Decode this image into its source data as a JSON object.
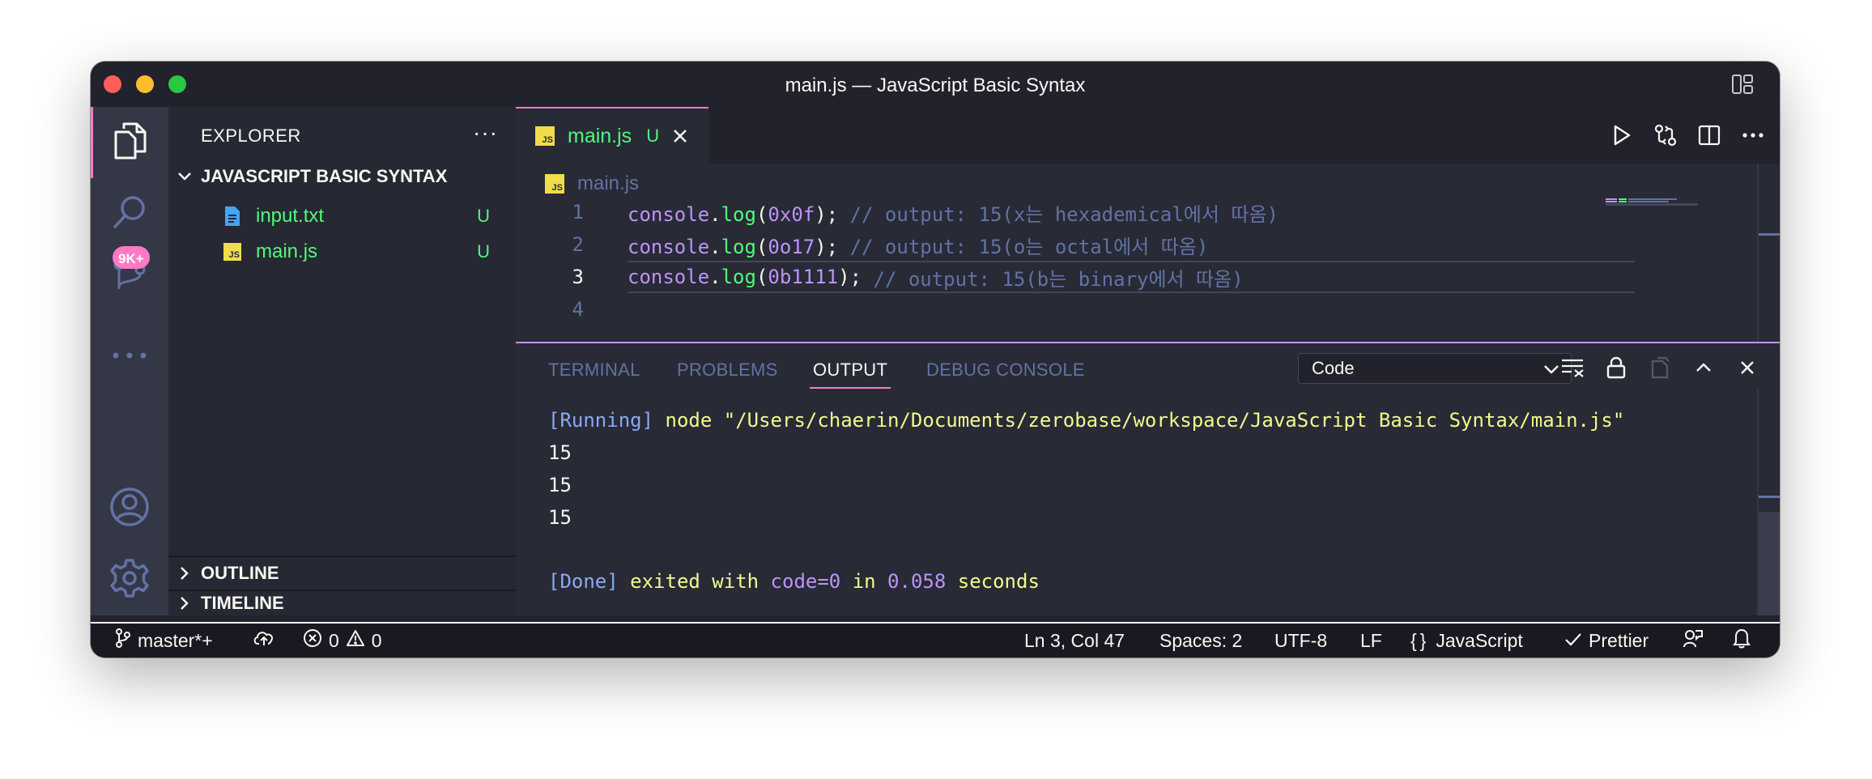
{
  "window": {
    "title": "main.js — JavaScript Basic Syntax"
  },
  "activity_bar": {
    "scm_badge": "9K+"
  },
  "explorer": {
    "title": "EXPLORER",
    "more": "···",
    "folder": "JAVASCRIPT BASIC SYNTAX",
    "files": [
      {
        "name": "input.txt",
        "status": "U",
        "icon": "text-file-icon"
      },
      {
        "name": "main.js",
        "status": "U",
        "icon": "js-file-icon"
      }
    ],
    "outline": "OUTLINE",
    "timeline": "TIMELINE"
  },
  "editor": {
    "tab": {
      "label": "main.js",
      "status": "U",
      "icon_text": "JS"
    },
    "breadcrumb": "main.js",
    "lines": [
      {
        "num": "1",
        "obj": "console",
        "dot": ".",
        "fn": "log",
        "open": "(",
        "arg": "0x0f",
        "close": ");",
        "comment": " // output: 15(x는 hexademical에서 따옴)"
      },
      {
        "num": "2",
        "obj": "console",
        "dot": ".",
        "fn": "log",
        "open": "(",
        "arg": "0o17",
        "close": ");",
        "comment": " // output: 15(o는 octal에서 따옴)"
      },
      {
        "num": "3",
        "obj": "console",
        "dot": ".",
        "fn": "log",
        "open": "(",
        "arg": "0b1111",
        "close": ");",
        "comment": " // output: 15(b는 binary에서 따옴)"
      },
      {
        "num": "4"
      }
    ]
  },
  "panel": {
    "tabs": [
      "TERMINAL",
      "PROBLEMS",
      "OUTPUT",
      "DEBUG CONSOLE"
    ],
    "active_tab": "OUTPUT",
    "dropdown_value": "Code",
    "output": {
      "running_tag": "[Running]",
      "command": " node \"/Users/chaerin/Documents/zerobase/workspace/JavaScript Basic Syntax/main.js\"",
      "results": [
        "15",
        "15",
        "15"
      ],
      "done_tag": "[Done]",
      "done_text1": " exited with ",
      "done_code": "code=0",
      "done_text2": " in ",
      "done_time": "0.058",
      "done_text3": " seconds"
    }
  },
  "statusbar": {
    "branch": "master*+",
    "errors": "0",
    "warnings": "0",
    "position": "Ln 3, Col 47",
    "spaces": "Spaces: 2",
    "encoding": "UTF-8",
    "eol": "LF",
    "language_braces": "{}",
    "language": "JavaScript",
    "formatter": "Prettier"
  },
  "colors": {
    "accent": "#ff79c6",
    "untracked": "#50fa7b",
    "background": "#282a36"
  }
}
